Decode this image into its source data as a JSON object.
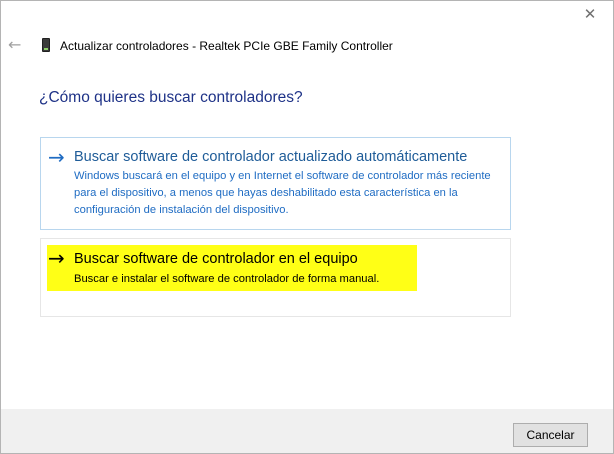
{
  "window": {
    "close_glyph": "✕",
    "back_glyph": "←",
    "title": "Actualizar controladores - Realtek PCIe GBE Family Controller"
  },
  "main": {
    "heading": "¿Cómo quieres buscar controladores?",
    "options": [
      {
        "title": "Buscar software de controlador actualizado automáticamente",
        "description": "Windows buscará en el equipo y en Internet el software de controlador más reciente para el dispositivo, a menos que hayas deshabilitado esta característica en la configuración de instalación del dispositivo."
      },
      {
        "title": "Buscar software de controlador en el equipo",
        "description": "Buscar e instalar el software de controlador de forma manual."
      }
    ],
    "arrow_glyph": "→"
  },
  "footer": {
    "cancel_label": "Cancelar"
  },
  "colors": {
    "heading": "#1e3287",
    "link": "#1f6cc3",
    "highlight": "#ffff16"
  }
}
